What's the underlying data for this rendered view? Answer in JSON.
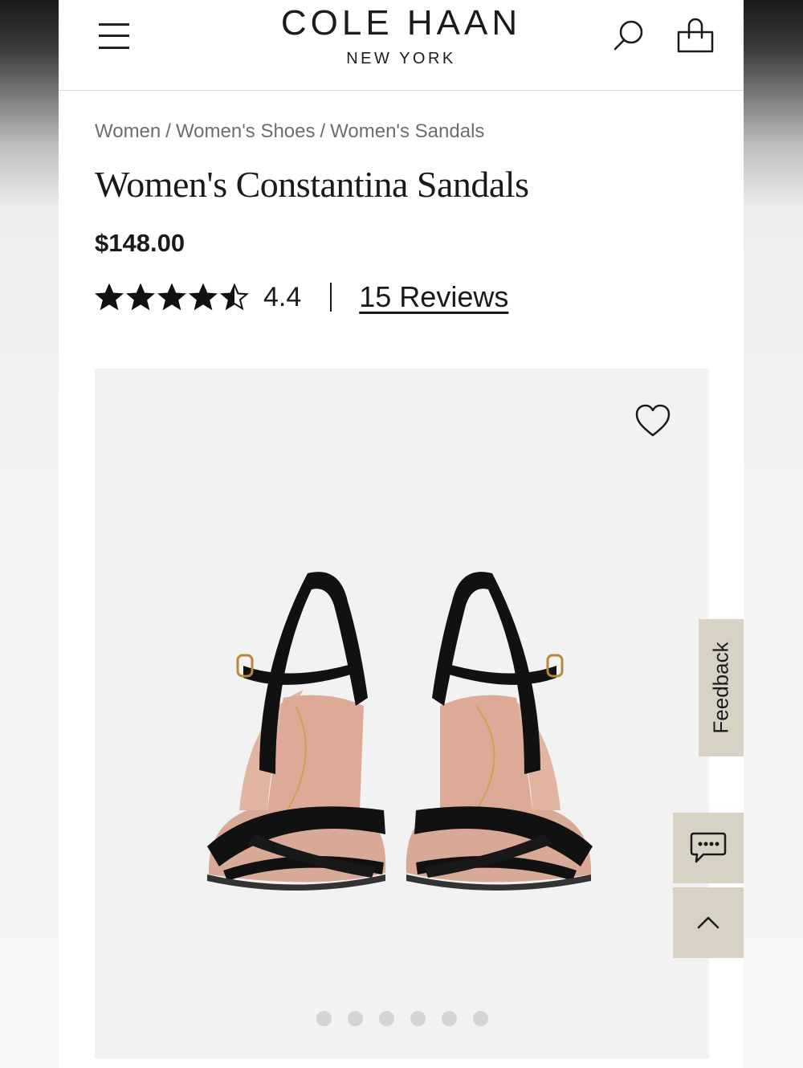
{
  "header": {
    "brand": "COLE HAAN",
    "brand_sub": "NEW YORK",
    "menu_icon": "hamburger-menu-icon",
    "search_icon": "search-icon",
    "bag_icon": "shopping-bag-icon"
  },
  "breadcrumb": {
    "items": [
      "Women",
      "Women's Shoes",
      "Women's Sandals"
    ],
    "separator": "/"
  },
  "product": {
    "title": "Women's Constantina Sandals",
    "price": "$148.00",
    "rating_value": "4.4",
    "rating_stars": 4.4,
    "rating_max": 5,
    "reviews_label": "15 Reviews"
  },
  "gallery": {
    "wishlist_icon": "heart-icon",
    "image_count": 6,
    "active_index": 0
  },
  "floating": {
    "feedback_label": "Feedback",
    "chat_icon": "chat-bubble-icon",
    "back_to_top_icon": "chevron-up-icon"
  },
  "colors": {
    "accent_tab": "#d7d2c4",
    "text": "#1a1a1a",
    "breadcrumb": "#6d6d6d",
    "gallery_bg": "#f2f2f2"
  }
}
